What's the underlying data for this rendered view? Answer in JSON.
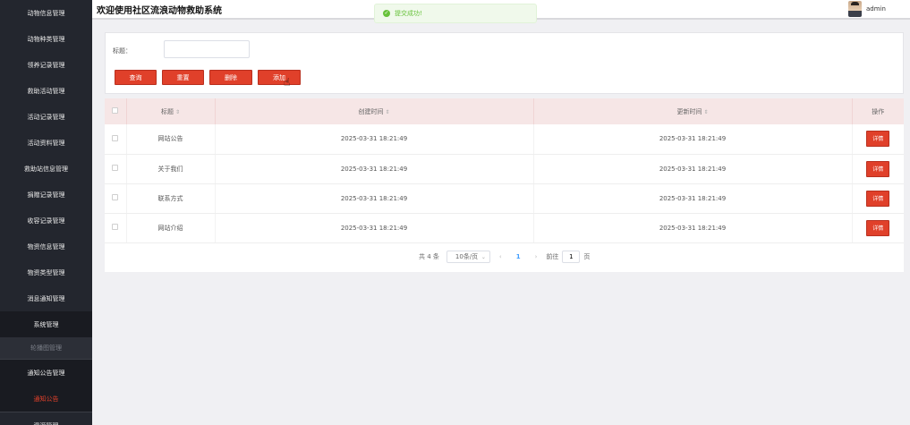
{
  "header": {
    "title": "欢迎使用社区流浪动物救助系统",
    "username": "admin"
  },
  "toast": {
    "message": "提交成功!"
  },
  "sidebar": {
    "items": [
      {
        "label": "动物信息管理"
      },
      {
        "label": "动物种类管理"
      },
      {
        "label": "领养记录管理"
      },
      {
        "label": "救助活动管理"
      },
      {
        "label": "活动记录管理"
      },
      {
        "label": "活动资料管理"
      },
      {
        "label": "救助站信息管理"
      },
      {
        "label": "捐赠记录管理"
      },
      {
        "label": "收容记录管理"
      },
      {
        "label": "物资信息管理"
      },
      {
        "label": "物资类型管理"
      },
      {
        "label": "消息通知管理"
      },
      {
        "label": "系统管理"
      },
      {
        "label": "轮播图管理"
      },
      {
        "label": "通知公告管理"
      },
      {
        "label": "通知公告"
      },
      {
        "label": "资源管理"
      }
    ]
  },
  "search": {
    "label": "标题：",
    "value": "",
    "placeholder": ""
  },
  "buttons": {
    "query": "查询",
    "reset": "重置",
    "delete": "删除",
    "add": "添加"
  },
  "table": {
    "headers": {
      "title": "标题",
      "created": "创建时间",
      "updated": "更新时间",
      "actions": "操作"
    },
    "rows": [
      {
        "title": "网站公告",
        "created": "2025-03-31 18:21:49",
        "updated": "2025-03-31 18:21:49",
        "action": "详情"
      },
      {
        "title": "关于我们",
        "created": "2025-03-31 18:21:49",
        "updated": "2025-03-31 18:21:49",
        "action": "详情"
      },
      {
        "title": "联系方式",
        "created": "2025-03-31 18:21:49",
        "updated": "2025-03-31 18:21:49",
        "action": "详情"
      },
      {
        "title": "网站介绍",
        "created": "2025-03-31 18:21:49",
        "updated": "2025-03-31 18:21:49",
        "action": "详情"
      }
    ]
  },
  "pagination": {
    "total": "共 4 条",
    "page_size": "10条/页",
    "current": "1",
    "goto_label": "前往",
    "goto_value": "1",
    "page_suffix": "页"
  }
}
